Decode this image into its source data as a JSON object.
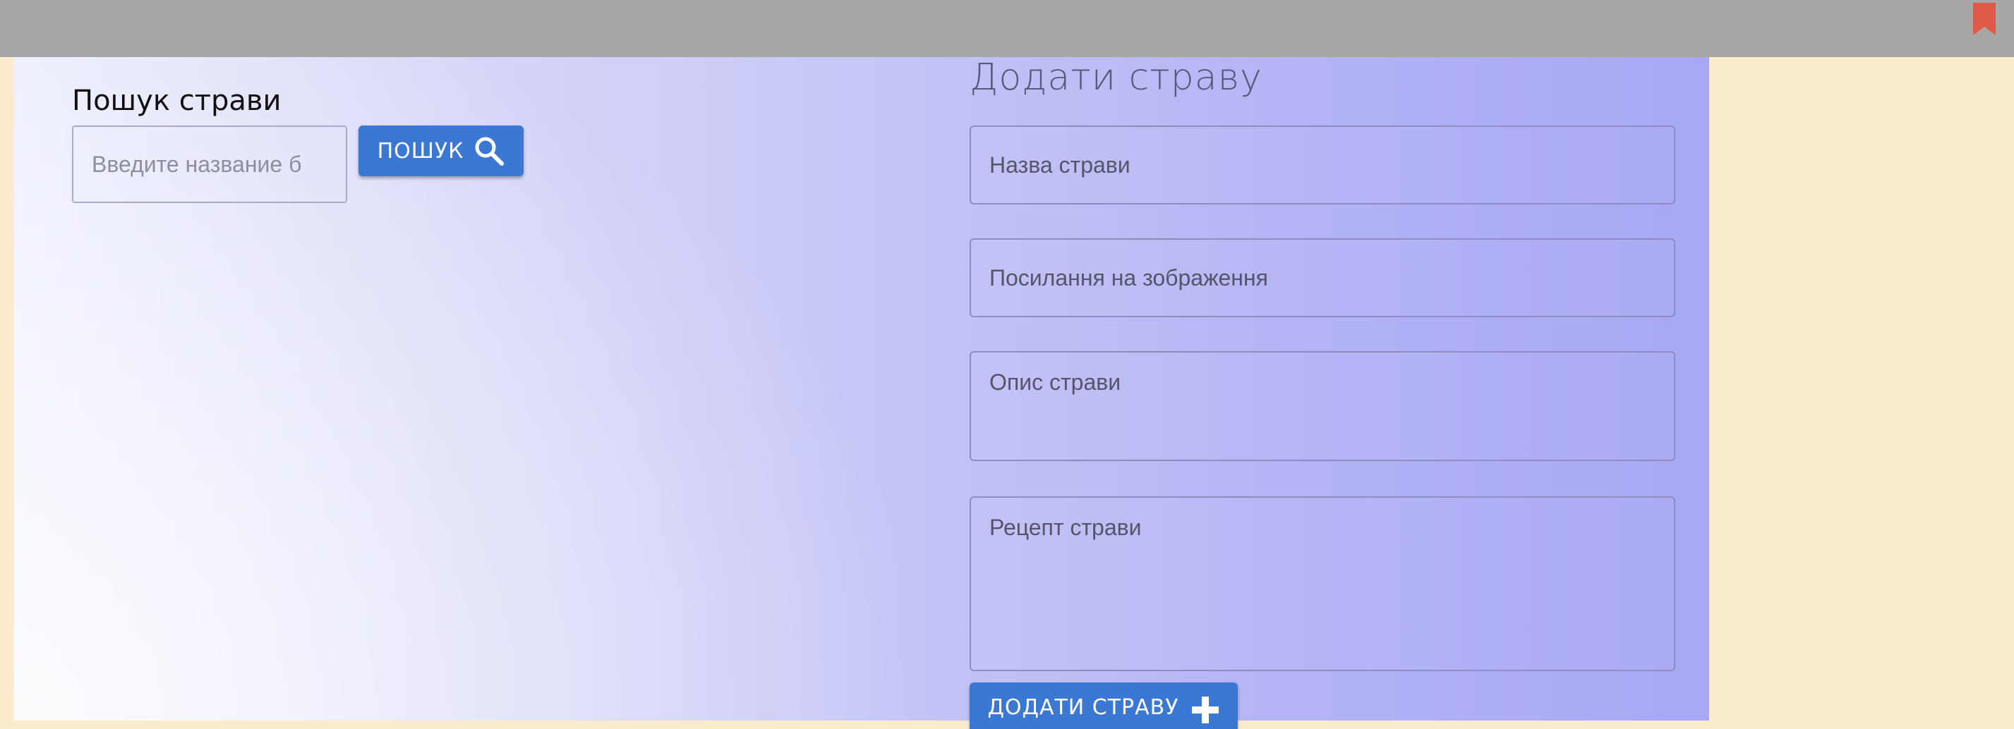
{
  "search": {
    "title": "Пошук страви",
    "placeholder": "Введите название б",
    "button_label": "ПОШУК"
  },
  "add_dish": {
    "title": "Додати страву",
    "name_placeholder": "Назва страви",
    "image_placeholder": "Посилання на зображення",
    "description_placeholder": "Опис страви",
    "recipe_placeholder": "Рецепт страви",
    "button_label": "ДОДАТИ СТРАВУ"
  },
  "icons": {
    "search_button_icon": "search-icon",
    "add_button_icon": "plus-icon",
    "bookmark_icon": "bookmark-icon"
  },
  "colors": {
    "button": "#3a78d4",
    "topbar": "#a7a7a7",
    "page_background": "#fbecd0",
    "bookmark": "#e05a48"
  }
}
